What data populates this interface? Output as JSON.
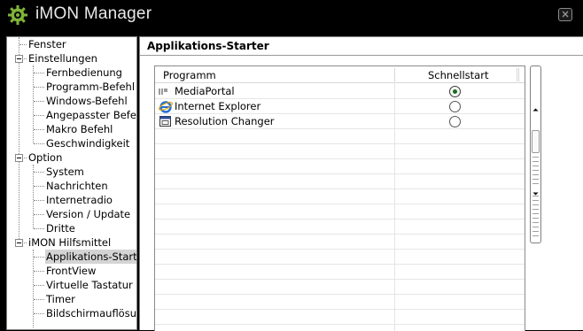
{
  "window": {
    "title": "iMON Manager",
    "close_icon": "close-icon",
    "logo_icon": "imon-gear-logo-icon"
  },
  "tree": {
    "nodes": [
      {
        "label": "Fenster",
        "level": 0,
        "expandable": false
      },
      {
        "label": "Einstellungen",
        "level": 0,
        "expandable": true
      },
      {
        "label": "Fernbedienung",
        "level": 1
      },
      {
        "label": "Programm-Befehl",
        "level": 1
      },
      {
        "label": "Windows-Befehl",
        "level": 1
      },
      {
        "label": "Angepasster Befehl",
        "level": 1
      },
      {
        "label": "Makro  Befehl",
        "level": 1
      },
      {
        "label": "Geschwindigkeit",
        "level": 1
      },
      {
        "label": "Option",
        "level": 0,
        "expandable": true
      },
      {
        "label": "System",
        "level": 1
      },
      {
        "label": "Nachrichten",
        "level": 1
      },
      {
        "label": "Internetradio",
        "level": 1
      },
      {
        "label": "Version / Update",
        "level": 1
      },
      {
        "label": "Dritte",
        "level": 1
      },
      {
        "label": "iMON Hilfsmittel",
        "level": 0,
        "expandable": true
      },
      {
        "label": "Applikations-Starter",
        "level": 1,
        "selected": true
      },
      {
        "label": "FrontView",
        "level": 1
      },
      {
        "label": "Virtuelle Tastatur",
        "level": 1
      },
      {
        "label": "Timer",
        "level": 1
      },
      {
        "label": "Bildschirmauflösung",
        "level": 1
      }
    ]
  },
  "panel": {
    "title": "Applikations-Starter",
    "list": {
      "columns": [
        "Programm",
        "Schnellstart"
      ],
      "rows": [
        {
          "name": "MediaPortal",
          "icon": "mediaportal-icon",
          "quickstart": true
        },
        {
          "name": "Internet Explorer",
          "icon": "internet-explorer-icon",
          "quickstart": false
        },
        {
          "name": "Resolution Changer",
          "icon": "resolution-changer-icon",
          "quickstart": false
        }
      ]
    },
    "scrollbar": {
      "up_icon": "scroll-up-arrow-icon",
      "down_icon": "scroll-down-arrow-icon"
    }
  },
  "colors": {
    "titlebar": "#000000",
    "selection": "#d4d4d4",
    "radio_checked": "#1a6b1a"
  }
}
